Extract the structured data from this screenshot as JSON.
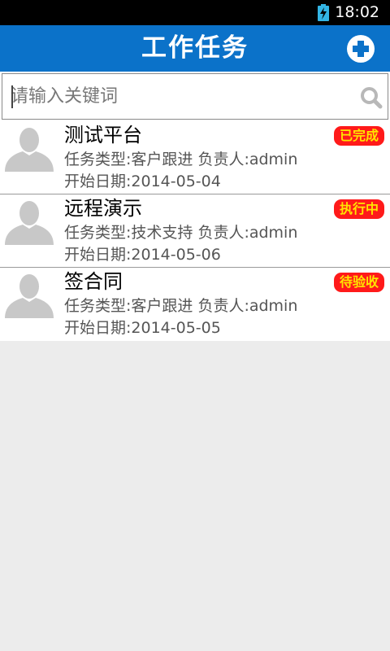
{
  "status_bar": {
    "time": "18:02",
    "battery_icon": "battery-charging-icon",
    "battery_color": "#33b5e5"
  },
  "header": {
    "title": "工作任务",
    "add_icon": "plus-circle-icon",
    "background": "#0b72c9"
  },
  "search": {
    "placeholder": "请输入关键词",
    "value": "",
    "icon": "search-icon"
  },
  "tasks": [
    {
      "title": "测试平台",
      "type_line": "任务类型:客户跟进 负责人:admin",
      "date_line": "开始日期:2014-05-04",
      "status": "已完成",
      "avatar_icon": "user-avatar-icon"
    },
    {
      "title": "远程演示",
      "type_line": "任务类型:技术支持 负责人:admin",
      "date_line": "开始日期:2014-05-06",
      "status": "执行中",
      "avatar_icon": "user-avatar-icon"
    },
    {
      "title": "签合同",
      "type_line": "任务类型:客户跟进 负责人:admin",
      "date_line": "开始日期:2014-05-05",
      "status": "待验收",
      "avatar_icon": "user-avatar-icon"
    }
  ],
  "colors": {
    "badge_bg": "#ff1a1a",
    "badge_text": "#ffe400",
    "list_bg": "#ececec"
  }
}
